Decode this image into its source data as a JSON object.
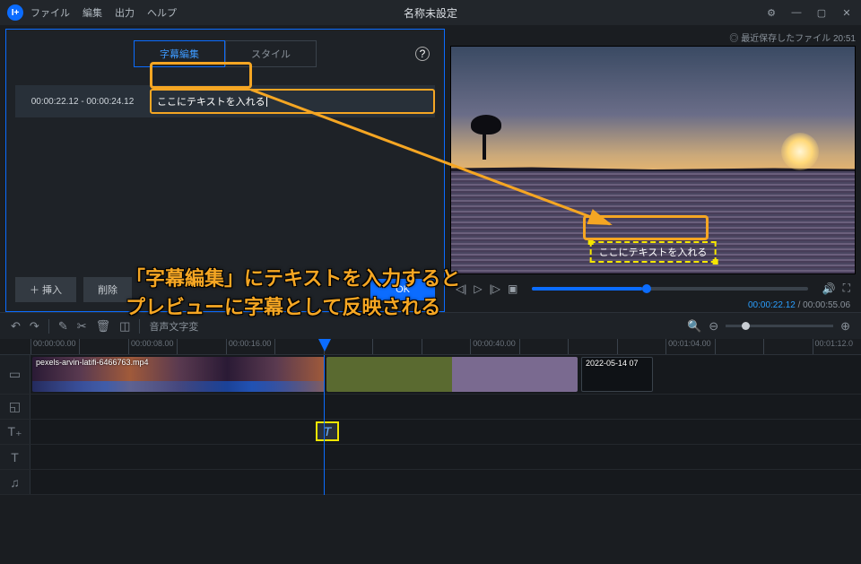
{
  "titlebar": {
    "app_badge": "I+",
    "menu": {
      "file": "ファイル",
      "edit": "編集",
      "output": "出力",
      "help": "ヘルプ"
    },
    "title": "名称未設定",
    "win": {
      "settings": "⚙",
      "min": "—",
      "max": "▢",
      "close": "✕"
    }
  },
  "subtitle_panel": {
    "tab_edit": "字幕編集",
    "tab_style": "スタイル",
    "help_glyph": "?",
    "row_time": "00:00:22.12 - 00:00:24.12",
    "row_text": "ここにテキストを入れる",
    "btn_insert": "＋ 挿入",
    "btn_delete": "削除",
    "btn_ok": "OK"
  },
  "preview": {
    "recent_saved": "最近保存したファイル 20:51",
    "subtitle_overlay": "ここにテキストを入れる",
    "play": {
      "prev": "◁|",
      "play": "▷",
      "next": "|▷",
      "stop": "▣",
      "vol": "🔊",
      "full": "⛶"
    },
    "time_current": "00:00:22.12",
    "time_total": "00:00:55.06"
  },
  "timeline_toolbar": {
    "undo": "↶",
    "redo": "↷",
    "mark": "✎",
    "cut": "✂",
    "trash": "🗑",
    "crop": "◫",
    "ai_voice_btn": "音声文字変",
    "search": "🔍",
    "zoom_out": "⊖",
    "zoom_in": "⊕"
  },
  "ruler": [
    "00:00:00.00",
    "",
    "00:00:08.00",
    "",
    "00:00:16.00",
    "",
    "",
    "",
    "",
    "00:00:40.00",
    "",
    "",
    "",
    "00:01:04.00",
    "",
    "",
    "00:01:12.0"
  ],
  "tracks": {
    "video_icon": "▭",
    "pip_icon": "◱",
    "text1_icon": "T₊",
    "text2_icon": "T",
    "audio_icon": "♫",
    "clip1_label": "pexels-arvin-latifi-6466763.mp4",
    "clip3_label": "2022-05-14 07",
    "text_clip_glyph": "T"
  },
  "annotation": {
    "line1": "「字幕編集」にテキストを入力すると",
    "line2": "プレビューに字幕として反映される"
  }
}
